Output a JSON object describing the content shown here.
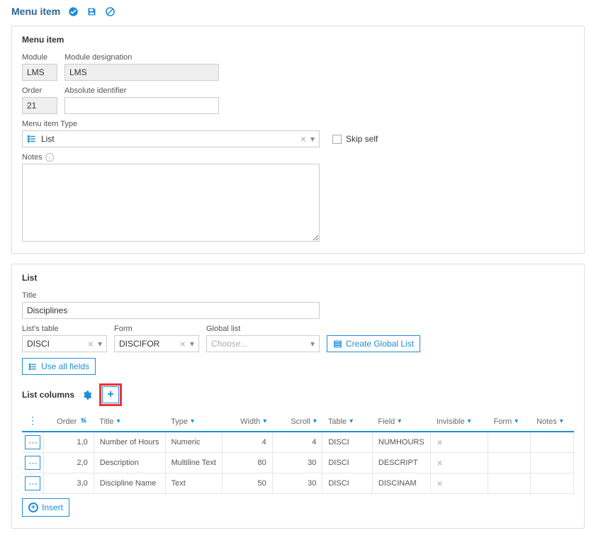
{
  "header": {
    "title": "Menu item"
  },
  "menuItemPanel": {
    "title": "Menu item",
    "labels": {
      "module": "Module",
      "moduleDesignation": "Module designation",
      "order": "Order",
      "absoluteIdentifier": "Absolute identifier",
      "menuItemType": "Menu item Type",
      "skipSelf": "Skip self",
      "notes": "Notes"
    },
    "values": {
      "module": "LMS",
      "moduleDesignation": "LMS",
      "order": "21",
      "absoluteIdentifier": "",
      "menuItemType": "List",
      "skipSelf": false,
      "notes": ""
    }
  },
  "listPanel": {
    "title": "List",
    "labels": {
      "title": "Title",
      "listsTable": "List's table",
      "form": "Form",
      "globalList": "Global list",
      "createGlobalList": "Create Global List",
      "useAllFields": "Use all fields",
      "listColumns": "List columns",
      "insert": "Insert",
      "choosePlaceholder": "Choose..."
    },
    "values": {
      "title": "Disciplines",
      "listsTable": "DISCI",
      "form": "DISCIFOR",
      "globalList": ""
    },
    "columnsHeaders": {
      "order": "Order",
      "title": "Title",
      "type": "Type",
      "width": "Width",
      "scroll": "Scroll",
      "table": "Table",
      "field": "Field",
      "invisible": "Invisible",
      "form": "Form",
      "notes": "Notes"
    },
    "rows": [
      {
        "order": "1,0",
        "title": "Number of Hours",
        "type": "Numeric",
        "width": "4",
        "scroll": "4",
        "table": "DISCI",
        "field": "NUMHOURS"
      },
      {
        "order": "2,0",
        "title": "Description",
        "type": "Multiline Text",
        "width": "80",
        "scroll": "30",
        "table": "DISCI",
        "field": "DESCRIPT"
      },
      {
        "order": "3,0",
        "title": "Discipline Name",
        "type": "Text",
        "width": "50",
        "scroll": "30",
        "table": "DISCI",
        "field": "DISCINAM"
      }
    ]
  }
}
